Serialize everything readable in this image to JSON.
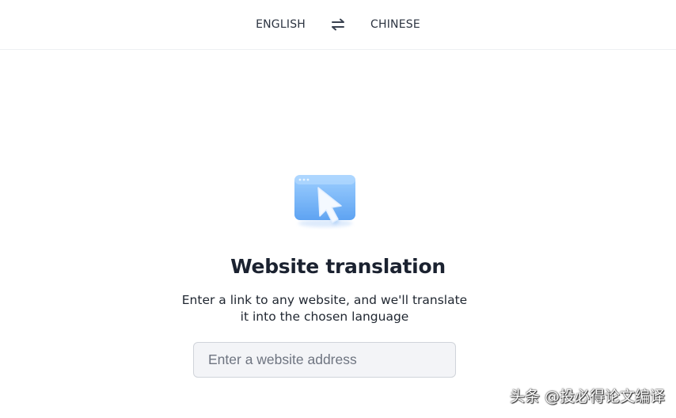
{
  "language_bar": {
    "source_language": "ENGLISH",
    "target_language": "CHINESE",
    "swap_icon": "swap-arrows-icon"
  },
  "hero": {
    "icon": "browser-cursor-icon",
    "title": "Website translation",
    "subtitle": "Enter a link to any website, and we'll translate it into the chosen language"
  },
  "url_input": {
    "value": "",
    "placeholder": "Enter a website address"
  },
  "watermark": {
    "text": "头条 @投必得论文编译"
  },
  "colors": {
    "accent": "#6aaef7",
    "text": "#1b2230",
    "input_bg": "#f3f4f7"
  }
}
